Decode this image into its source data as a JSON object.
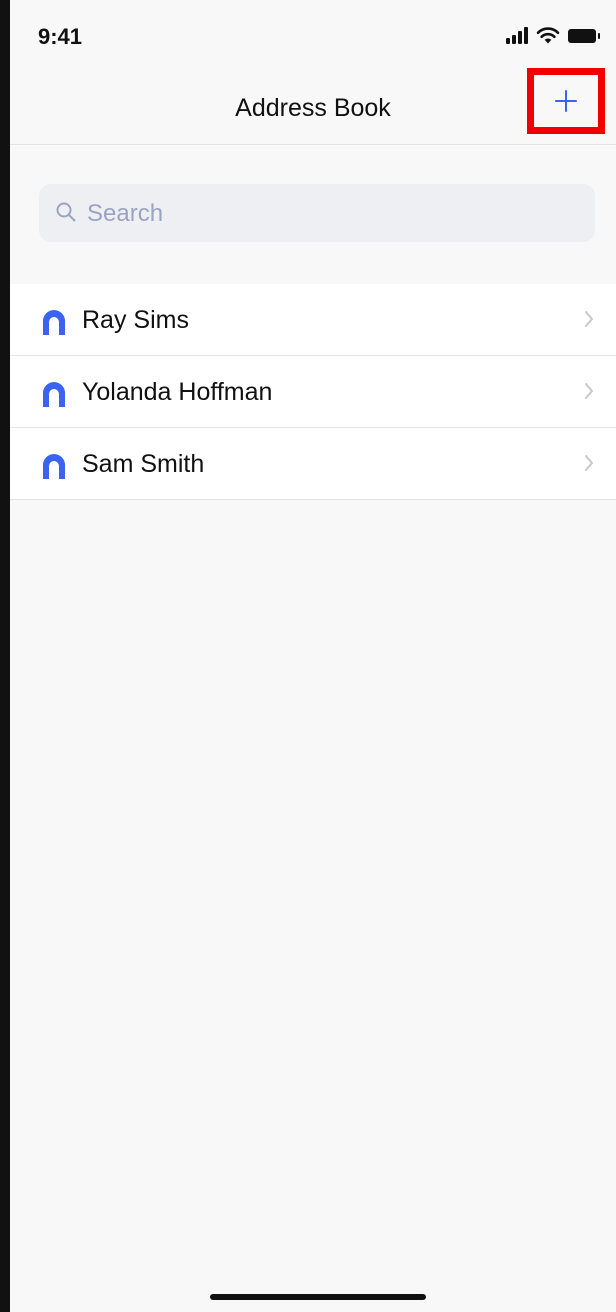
{
  "status_bar": {
    "time": "9:41",
    "icons": [
      "cellular-signal-icon",
      "wifi-icon",
      "battery-icon"
    ]
  },
  "nav": {
    "title": "Address Book",
    "add_button_icon": "plus-icon",
    "accent_color": "#3a63f2",
    "highlight_color": "#f00000"
  },
  "search": {
    "placeholder": "Search",
    "icon": "search-icon"
  },
  "contacts": [
    {
      "name": "Ray Sims"
    },
    {
      "name": "Yolanda Hoffman"
    },
    {
      "name": "Sam Smith"
    }
  ],
  "icons": {
    "contact_avatar": "person-icon",
    "row_disclosure": "chevron-right-icon"
  }
}
